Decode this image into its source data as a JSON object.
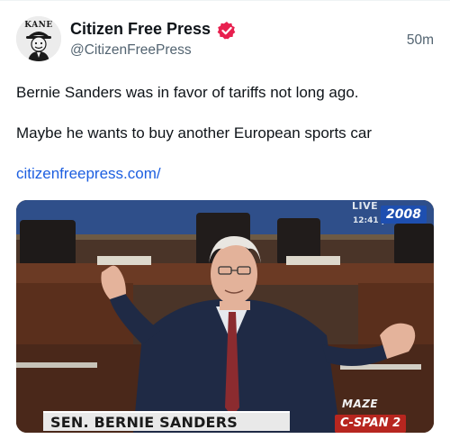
{
  "account": {
    "display_name": "Citizen Free Press",
    "handle": "@CitizenFreePress",
    "timestamp": "50m",
    "avatar_icon": "kane-logo-avatar",
    "avatar_text": "KANE",
    "verified_color": "#e8204f"
  },
  "post": {
    "line1": "Bernie Sanders was in favor of tariffs not long ago.",
    "line2": "Maybe he wants to buy another European sports car",
    "link": "citizenfreepress.com/",
    "link_color": "#1d5fe0"
  },
  "media": {
    "live_label": "LIVE",
    "clock": "12:41 pm ET",
    "year": "2008",
    "watermark": "MAZE",
    "lower_third": "SEN. BERNIE SANDERS",
    "network": "C-SPAN 2"
  }
}
